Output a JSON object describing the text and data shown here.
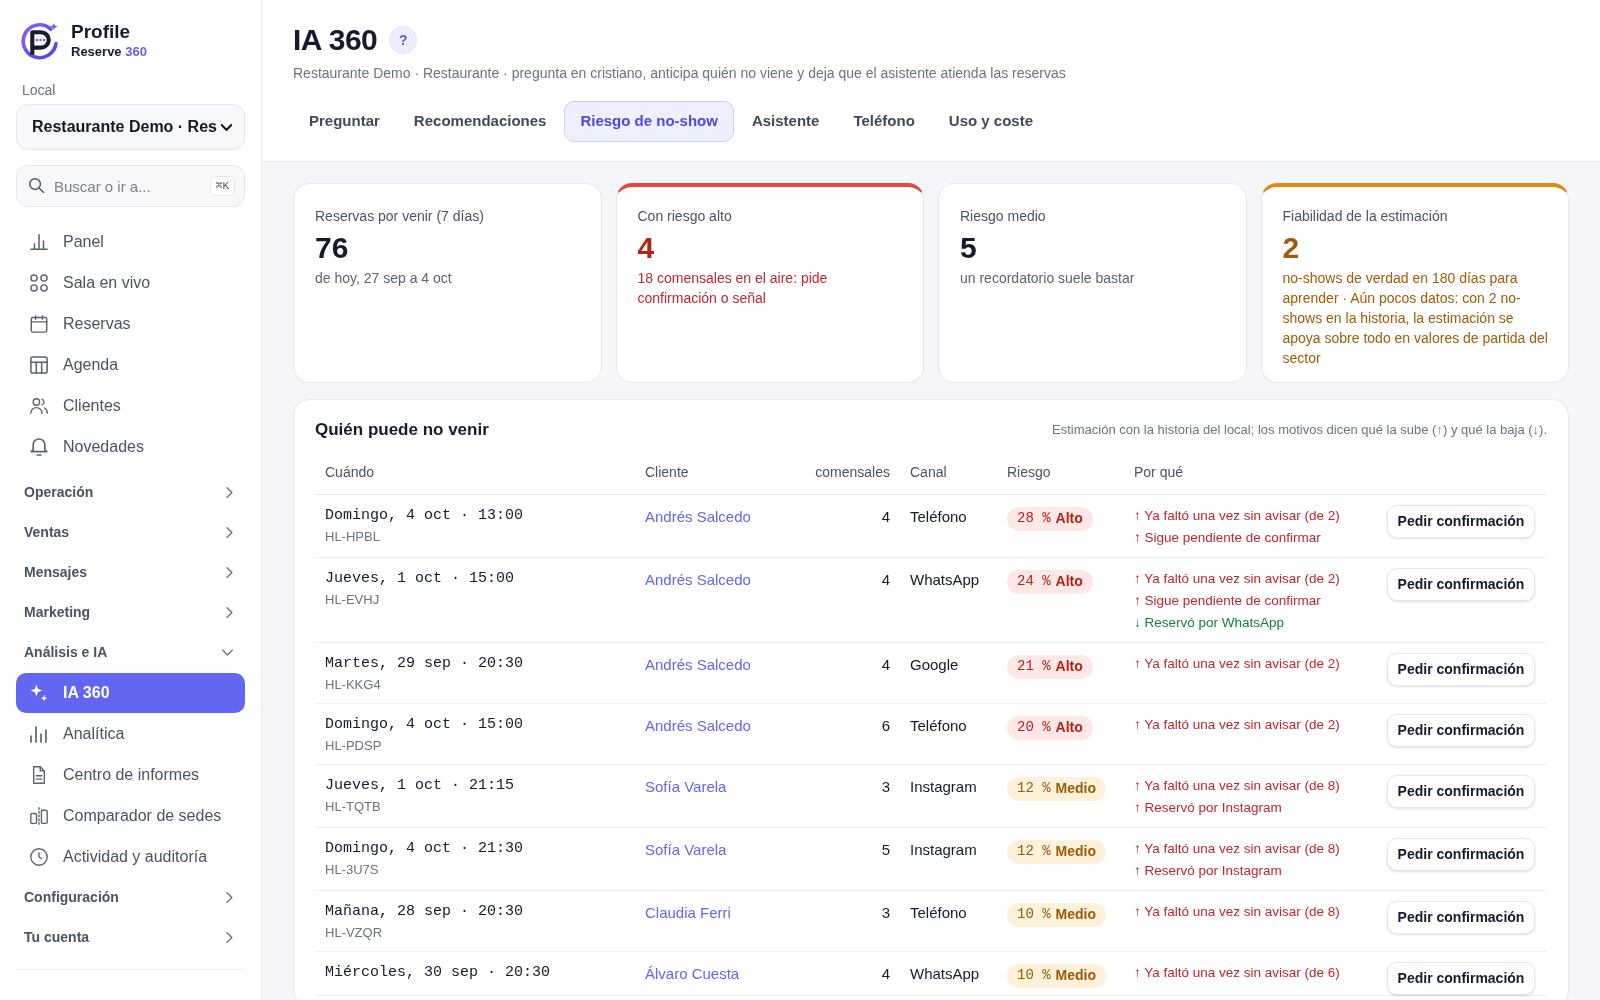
{
  "sidebar": {
    "brand": {
      "name": "Profile",
      "product": "Reserve",
      "product_number": "360"
    },
    "local_label": "Local",
    "local_select": {
      "value": "Restaurante Demo · Res"
    },
    "search": {
      "placeholder": "Buscar o ir a...",
      "shortcut": "⌘K"
    },
    "nav": [
      {
        "kind": "link",
        "label": "Panel",
        "selected": false
      },
      {
        "kind": "link",
        "label": "Sala en vivo",
        "selected": false
      },
      {
        "kind": "link",
        "label": "Reservas",
        "selected": false
      },
      {
        "kind": "link",
        "label": "Agenda",
        "selected": false
      },
      {
        "kind": "link",
        "label": "Clientes",
        "selected": false
      },
      {
        "kind": "link",
        "label": "Novedades",
        "selected": false
      },
      {
        "kind": "group",
        "label": "Operación",
        "expanded": false
      },
      {
        "kind": "group",
        "label": "Ventas",
        "expanded": false
      },
      {
        "kind": "group",
        "label": "Mensajes",
        "expanded": false
      },
      {
        "kind": "group",
        "label": "Marketing",
        "expanded": false
      },
      {
        "kind": "group",
        "label": "Análisis e IA",
        "expanded": true,
        "children": [
          {
            "label": "IA 360",
            "selected": true
          },
          {
            "label": "Analítica",
            "selected": false
          },
          {
            "label": "Centro de informes",
            "selected": false
          },
          {
            "label": "Comparador de sedes",
            "selected": false
          },
          {
            "label": "Actividad y auditoría",
            "selected": false
          }
        ]
      },
      {
        "kind": "group",
        "label": "Configuración",
        "expanded": false
      },
      {
        "kind": "group",
        "label": "Tu cuenta",
        "expanded": false
      }
    ]
  },
  "header": {
    "title": "IA 360",
    "help": "?",
    "subtitle": "Restaurante Demo · Restaurante · pregunta en cristiano, anticipa quién no viene y deja que el asistente atienda las reservas",
    "tabs": [
      {
        "label": "Preguntar",
        "selected": false
      },
      {
        "label": "Recomendaciones",
        "selected": false
      },
      {
        "label": "Riesgo de no-show",
        "selected": true
      },
      {
        "label": "Asistente",
        "selected": false
      },
      {
        "label": "Teléfono",
        "selected": false
      },
      {
        "label": "Uso y coste",
        "selected": false
      }
    ]
  },
  "stats": [
    {
      "label": "Reservas por venir (7 días)",
      "value": "76",
      "note": "de hoy, 27 sep a 4 oct",
      "kind": "plain"
    },
    {
      "label": "Con riesgo alto",
      "value": "4",
      "note": "18 comensales en el aire: pide confirmación o señal",
      "kind": "alert"
    },
    {
      "label": "Riesgo medio",
      "value": "5",
      "note": "un recordatorio suele bastar",
      "kind": "plain"
    },
    {
      "label": "Fiabilidad de la estimación",
      "value": "2",
      "note": "no-shows de verdad en 180 días para aprender · Aún pocos datos: con 2 no-shows en la historia, la estimación se apoya sobre todo en valores de partida del sector",
      "kind": "warning"
    }
  ],
  "table": {
    "title": "Quién puede no venir",
    "note": "Estimación con la historia del local; los motivos dicen qué la sube (↑) y qué la baja (↓).",
    "columns": [
      "Cuándo",
      "Cliente",
      "comensales",
      "Canal",
      "Riesgo",
      "Por qué"
    ],
    "rows": [
      {
        "when": "Domingo, 4 oct · 13:00",
        "code": "HL-HPBL",
        "client": "Andrés Salcedo",
        "guests": "4",
        "channel": "Teléfono",
        "risk": {
          "percent": "28 %",
          "level": "Alto",
          "kind": "high"
        },
        "reasons": [
          {
            "text": "↑ Ya faltó una vez sin avisar (de 2)",
            "kind": "up"
          },
          {
            "text": "↑ Sigue pendiente de confirmar",
            "kind": "up"
          }
        ],
        "action": "Pedir confirmación"
      },
      {
        "when": "Jueves, 1 oct · 15:00",
        "code": "HL-EVHJ",
        "client": "Andrés Salcedo",
        "guests": "4",
        "channel": "WhatsApp",
        "risk": {
          "percent": "24 %",
          "level": "Alto",
          "kind": "high"
        },
        "reasons": [
          {
            "text": "↑ Ya faltó una vez sin avisar (de 2)",
            "kind": "up"
          },
          {
            "text": "↑ Sigue pendiente de confirmar",
            "kind": "up"
          },
          {
            "text": "↓ Reservó por WhatsApp",
            "kind": "down"
          }
        ],
        "action": "Pedir confirmación"
      },
      {
        "when": "Martes, 29 sep · 20:30",
        "code": "HL-KKG4",
        "client": "Andrés Salcedo",
        "guests": "4",
        "channel": "Google",
        "risk": {
          "percent": "21 %",
          "level": "Alto",
          "kind": "high"
        },
        "reasons": [
          {
            "text": "↑ Ya faltó una vez sin avisar (de 2)",
            "kind": "up"
          }
        ],
        "action": "Pedir confirmación"
      },
      {
        "when": "Domingo, 4 oct · 15:00",
        "code": "HL-PDSP",
        "client": "Andrés Salcedo",
        "guests": "6",
        "channel": "Teléfono",
        "risk": {
          "percent": "20 %",
          "level": "Alto",
          "kind": "high"
        },
        "reasons": [
          {
            "text": "↑ Ya faltó una vez sin avisar (de 2)",
            "kind": "up"
          }
        ],
        "action": "Pedir confirmación"
      },
      {
        "when": "Jueves, 1 oct · 21:15",
        "code": "HL-TQTB",
        "client": "Sofía Varela",
        "guests": "3",
        "channel": "Instagram",
        "risk": {
          "percent": "12 %",
          "level": "Medio",
          "kind": "medium"
        },
        "reasons": [
          {
            "text": "↑ Ya faltó una vez sin avisar (de 8)",
            "kind": "up"
          },
          {
            "text": "↑ Reservó por Instagram",
            "kind": "up"
          }
        ],
        "action": "Pedir confirmación"
      },
      {
        "when": "Domingo, 4 oct · 21:30",
        "code": "HL-3U7S",
        "client": "Sofía Varela",
        "guests": "5",
        "channel": "Instagram",
        "risk": {
          "percent": "12 %",
          "level": "Medio",
          "kind": "medium"
        },
        "reasons": [
          {
            "text": "↑ Ya faltó una vez sin avisar (de 8)",
            "kind": "up"
          },
          {
            "text": "↑ Reservó por Instagram",
            "kind": "up"
          }
        ],
        "action": "Pedir confirmación"
      },
      {
        "when": "Mañana, 28 sep · 20:30",
        "code": "HL-VZQR",
        "client": "Claudia Ferri",
        "guests": "3",
        "channel": "Teléfono",
        "risk": {
          "percent": "10 %",
          "level": "Medio",
          "kind": "medium"
        },
        "reasons": [
          {
            "text": "↑ Ya faltó una vez sin avisar (de 8)",
            "kind": "up"
          }
        ],
        "action": "Pedir confirmación"
      },
      {
        "when": "Miércoles, 30 sep · 20:30",
        "client": "Álvaro Cuesta",
        "guests": "4",
        "channel": "WhatsApp",
        "risk": {
          "percent": "10 %",
          "level": "Medio",
          "kind": "medium"
        },
        "reasons": [
          {
            "text": "↑ Ya faltó una vez sin avisar (de 6)",
            "kind": "up"
          }
        ],
        "action": "Pedir confirmación"
      }
    ]
  }
}
